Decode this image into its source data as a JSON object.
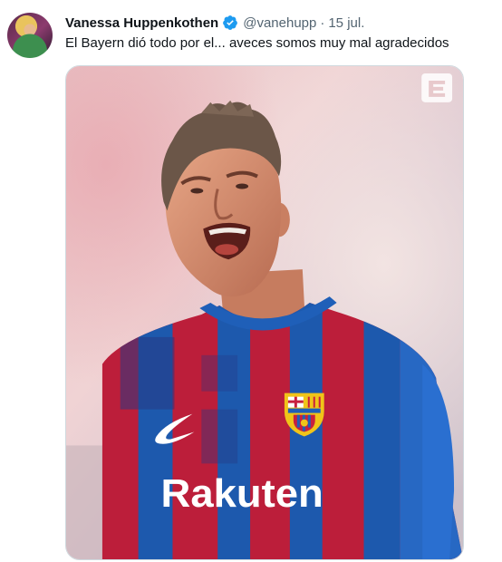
{
  "tweet": {
    "author_name": "Vanessa Huppenkothen",
    "handle": "@vanehupp",
    "separator": "·",
    "date": "15 jul.",
    "text": "El Bayern dió todo por el... aveces somos muy mal agradecidos",
    "verified_icon": "verified-badge-icon",
    "verified_color": "#1d9bf0"
  },
  "media": {
    "jersey_sponsor": "Rakuten",
    "jersey_colors": [
      "#c8203e",
      "#1f5fb8"
    ],
    "icons": [
      "nike-swoosh-icon",
      "club-crest-icon",
      "watermark-logo-icon"
    ]
  }
}
